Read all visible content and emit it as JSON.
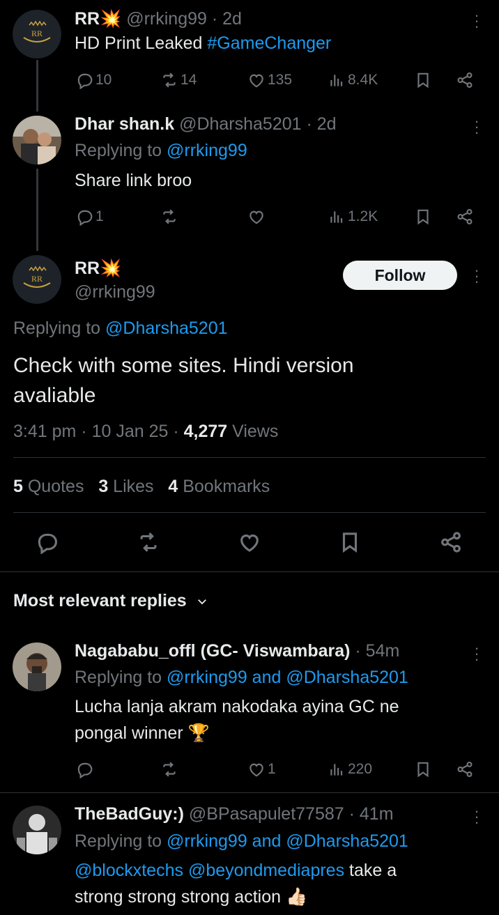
{
  "tweet1": {
    "name": "RR",
    "handle": "@rrking99",
    "time": "2d",
    "text_plain": "HD Print Leaked ",
    "hashtag": "#GameChanger",
    "replies": "10",
    "reposts": "14",
    "likes": "135",
    "views": "8.4K",
    "avatar_text": "RR"
  },
  "tweet2": {
    "name": "Dhar shan.k",
    "handle": "@Dharsha5201",
    "time": "2d",
    "replying_label": "Replying to ",
    "replying_to": "@rrking99",
    "text": "Share link broo",
    "replies": "1",
    "views": "1.2K"
  },
  "main_tweet": {
    "name": "RR",
    "handle": "@rrking99",
    "follow_label": "Follow",
    "replying_label": "Replying to ",
    "replying_to": "@Dharsha5201",
    "text_line1": "Check with some sites.  Hindi version",
    "text_line2": "avaliable",
    "time": "3:41 pm",
    "date": "10 Jan 25",
    "views_count": "4,277",
    "views_label": " Views",
    "quotes_count": "5",
    "quotes_label": " Quotes",
    "likes_count": "3",
    "likes_label": " Likes",
    "bookmarks_count": "4",
    "bookmarks_label": " Bookmarks",
    "avatar_text": "RR"
  },
  "replies_header": {
    "label": "Most relevant replies"
  },
  "reply1": {
    "name": "Nagababu_offl (GC- Viswambara)",
    "time": "54m",
    "replying_label": "Replying to ",
    "replying_to_1": "@rrking99",
    "and_label": " and ",
    "replying_to_2": "@Dharsha5201",
    "text_line1": "Lucha lanja akram nakodaka ayina GC ne",
    "text_line2": "pongal winner ",
    "likes": "1",
    "views": "220"
  },
  "reply2": {
    "name": "TheBadGuy:)",
    "handle": "@BPasapulet77587",
    "time": "41m",
    "replying_label": "Replying to ",
    "replying_to_1": "@rrking99",
    "and_label": " and ",
    "replying_to_2": "@Dharsha5201",
    "mention_1": "@blockxtechs",
    "mention_2": "@beyondmediapres",
    "text_rest": " take a",
    "text_line2": "strong strong strong action "
  },
  "colors": {
    "background": "#000000",
    "text": "#e7e9ea",
    "muted": "#71767b",
    "link": "#1d9bf0",
    "divider": "#2f3336"
  }
}
